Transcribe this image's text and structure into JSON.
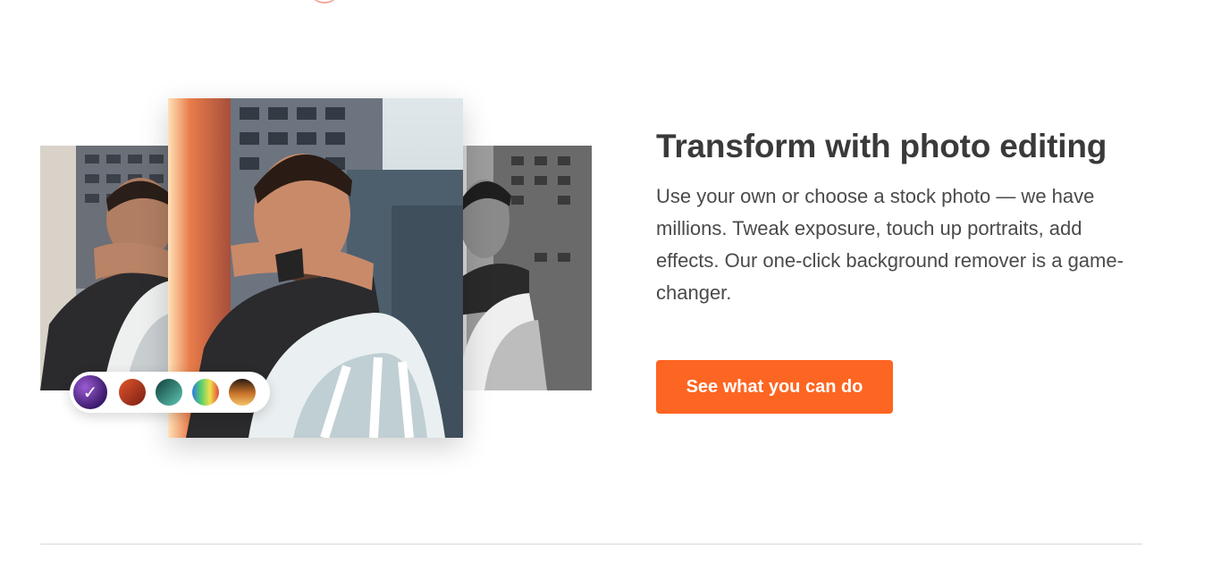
{
  "section": {
    "title": "Transform with photo editing",
    "body": "Use your own or choose a stock photo — we have millions. Tweak exposure, touch up portraits, add effects. Our one-click background remover is a game-changer.",
    "cta_label": "See what you can do"
  },
  "filters": {
    "active_check": "✓",
    "swatches": [
      "purple",
      "red-orange",
      "teal",
      "rainbow",
      "sunset"
    ]
  },
  "colors": {
    "accent": "#fd6522",
    "title": "#3a3a3a",
    "body": "#4a4a4a",
    "divider": "#e8e8e8"
  }
}
